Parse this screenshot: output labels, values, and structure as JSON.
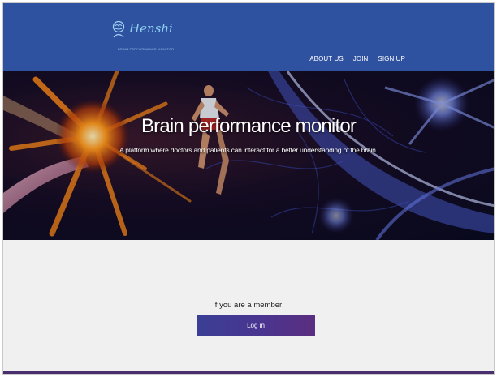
{
  "header": {
    "logo": {
      "name": "Henshi",
      "tagline": "Brain performance monitor",
      "icon": "brain-head-icon"
    },
    "nav": {
      "items": [
        {
          "label": "ABOUT US"
        },
        {
          "label": "JOIN"
        },
        {
          "label": "SIGN UP"
        }
      ]
    }
  },
  "hero": {
    "title": "Brain performance monitor",
    "subtitle": "A platform where doctors and patients can interact for a better understanding of the brain."
  },
  "main": {
    "member_prompt": "If you are a member:",
    "login_label": "Log in"
  },
  "colors": {
    "header_bg": "#2f52a0",
    "content_bg": "#f0f0f0",
    "button_start": "#3a3f95",
    "button_end": "#5a2e7f"
  }
}
